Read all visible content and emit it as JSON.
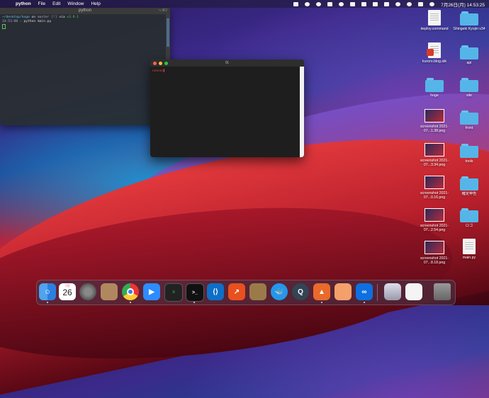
{
  "menubar": {
    "app_name": "python",
    "items": [
      "File",
      "Edit",
      "Window",
      "Help"
    ],
    "clock": "7月26日(月) 14:53:25"
  },
  "terminal": {
    "title": "python",
    "shortcut": "⌥⌘2",
    "prompt_path": "~/desktop/hoge",
    "prompt_on": "on",
    "git_branch": "master",
    "git_status": "[!]",
    "via": "via",
    "version": "v3.9.1",
    "time": "14:53:08",
    "command": "python main.py"
  },
  "tk_window": {
    "title": "tk",
    "entry_text": "nnnnnn"
  },
  "desktop_icons": [
    {
      "label": "deploy.command",
      "type": "doc"
    },
    {
      "label": "Shingeki Kyojin v34",
      "type": "folder"
    },
    {
      "label": "kuroro.blog.stk",
      "type": "doc-badge"
    },
    {
      "label": "api",
      "type": "folder"
    },
    {
      "label": "hoge",
      "type": "folder"
    },
    {
      "label": "site",
      "type": "folder"
    },
    {
      "label": "screenshot 2021-07...1.38.png",
      "type": "shot"
    },
    {
      "label": "front",
      "type": "folder"
    },
    {
      "label": "screenshot 2021-07...3.34.png",
      "type": "shot"
    },
    {
      "label": "tools",
      "type": "folder"
    },
    {
      "label": "screenshot 2021-07...0.16.png",
      "type": "shot"
    },
    {
      "label": "確定申告",
      "type": "folder"
    },
    {
      "label": "screenshot 2021-07...2.54.png",
      "type": "shot"
    },
    {
      "label": "ロゴ",
      "type": "folder"
    },
    {
      "label": "screenshot 2021-07...8.18.png",
      "type": "shot"
    },
    {
      "label": "main.py",
      "type": "doc"
    }
  ],
  "dock": {
    "calendar_month": "7月",
    "calendar_day": "26",
    "apps": [
      "finder",
      "calendar",
      "system-preferences",
      "contacts",
      "chrome",
      "zoom",
      "activity-monitor",
      "terminal",
      "vscode",
      "git-client",
      "archive-utility",
      "docker",
      "quicktime",
      "sourcetree",
      "preview",
      "infinity",
      "screenshot-folder",
      "document",
      "trash"
    ]
  },
  "colors": {
    "folder": "#55b5e8",
    "terminal_path": "#5fc3e4",
    "terminal_version": "#5fc35f",
    "tk_entry": "#e04040"
  }
}
